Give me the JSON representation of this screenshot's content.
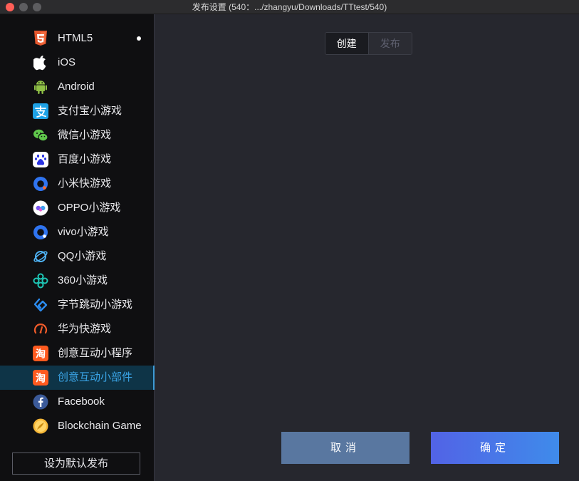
{
  "window": {
    "title": "发布设置 (540：.../zhangyu/Downloads/TTtest/540)"
  },
  "sidebar": {
    "items": [
      {
        "label": "HTML5",
        "icon": "html5-icon",
        "selected_dot": true
      },
      {
        "label": "iOS",
        "icon": "apple-icon"
      },
      {
        "label": "Android",
        "icon": "android-icon"
      },
      {
        "label": "支付宝小游戏",
        "icon": "alipay-icon"
      },
      {
        "label": "微信小游戏",
        "icon": "wechat-icon"
      },
      {
        "label": "百度小游戏",
        "icon": "baidu-icon"
      },
      {
        "label": "小米快游戏",
        "icon": "xiaomi-icon"
      },
      {
        "label": "OPPO小游戏",
        "icon": "oppo-icon"
      },
      {
        "label": "vivo小游戏",
        "icon": "vivo-icon"
      },
      {
        "label": "QQ小游戏",
        "icon": "qq-icon"
      },
      {
        "label": "360小游戏",
        "icon": "360-icon"
      },
      {
        "label": "字节跳动小游戏",
        "icon": "bytedance-icon"
      },
      {
        "label": "华为快游戏",
        "icon": "huawei-icon"
      },
      {
        "label": "创意互动小程序",
        "icon": "taobao-icon"
      },
      {
        "label": "创意互动小部件",
        "icon": "taobao-icon",
        "active": true
      },
      {
        "label": "Facebook",
        "icon": "facebook-icon"
      },
      {
        "label": "Blockchain Game",
        "icon": "blockchain-icon"
      }
    ],
    "default_button": "设为默认发布"
  },
  "main": {
    "tabs": [
      {
        "label": "创建",
        "active": true
      },
      {
        "label": "发布",
        "active": false
      }
    ],
    "cancel_label": "取消",
    "confirm_label": "确定"
  },
  "colors": {
    "accent": "#3aa4e6",
    "active_bg": "#0e3447",
    "cancel_bg": "#5977a0",
    "confirm_start": "#5263e6",
    "confirm_end": "#3f8bea"
  }
}
